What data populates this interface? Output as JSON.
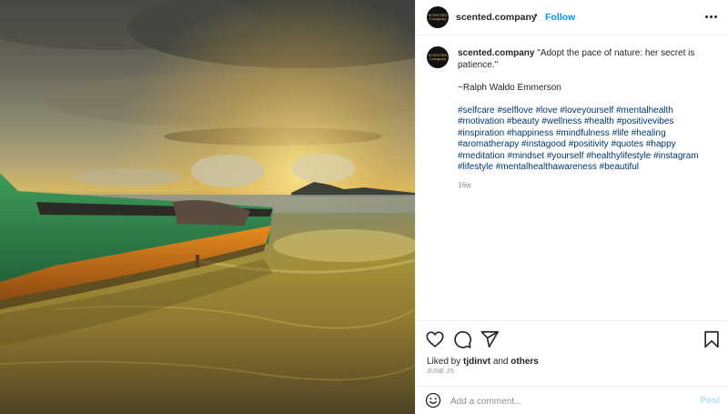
{
  "post": {
    "image_alt": "Green and orange wooden boat on a wet beach at sunset",
    "username": "scented.company",
    "avatar_text": "SCENTED Company",
    "separator": "•",
    "follow_label": "Follow"
  },
  "caption": {
    "username": "scented.company",
    "quote": "\"Adopt the pace of nature: her secret is patience.\"",
    "author": "~Ralph Waldo Emmerson",
    "hashtags": [
      "#selfcare",
      "#selflove",
      "#love",
      "#loveyourself",
      "#mentalhealth",
      "#motivation",
      "#beauty",
      "#wellness",
      "#health",
      "#positivevibes",
      "#inspiration",
      "#happiness",
      "#mindfulness",
      "#life",
      "#healing",
      "#aromatherapy",
      "#instagood",
      "#positivity",
      "#quotes",
      "#happy",
      "#meditation",
      "#mindset",
      "#yourself",
      "#healthylifestyle",
      "#instagram",
      "#lifestyle",
      "#mentalhealthawareness",
      "#beautiful"
    ],
    "time": "16w"
  },
  "icons": {
    "like": "heart-icon",
    "comment": "comment-icon",
    "share": "paper-plane-icon",
    "save": "bookmark-icon",
    "more": "more-horizontal-icon",
    "emoji": "smiley-icon"
  },
  "likes": {
    "prefix": "Liked by",
    "user": "tjdinvt",
    "conjunction": "and",
    "others": "others"
  },
  "date": "JUNE 25",
  "add_comment": {
    "placeholder": "Add a comment...",
    "post_label": "Post"
  },
  "colors": {
    "follow": "#0095f6",
    "hashtag": "#00376b",
    "post_disabled": "#b2dffc",
    "muted": "#8e8e8e"
  }
}
